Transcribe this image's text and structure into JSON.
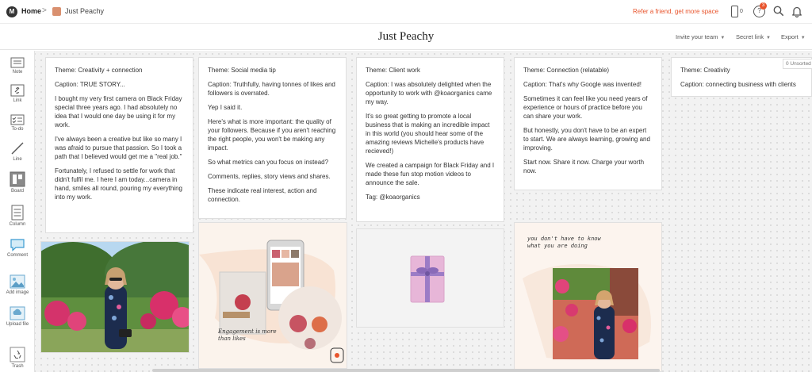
{
  "topbar": {
    "logo_letter": "M",
    "home_label": "Home",
    "separator": ">",
    "board_label": "Just Peachy",
    "refer_label": "Refer a friend, get more space",
    "device_count": "0",
    "notification_count": "3",
    "help_symbol": "?"
  },
  "titlebar": {
    "title": "Just Peachy",
    "invite_label": "Invite your team",
    "secret_link_label": "Secret link",
    "export_label": "Export"
  },
  "toolbar": {
    "items": [
      {
        "label": "Note",
        "icon": "note-icon"
      },
      {
        "label": "Link",
        "icon": "link-icon"
      },
      {
        "label": "To-do",
        "icon": "todo-icon"
      },
      {
        "label": "Line",
        "icon": "line-icon"
      },
      {
        "label": "Board",
        "icon": "board-icon"
      },
      {
        "label": "Column",
        "icon": "column-icon"
      },
      {
        "label": "Comment",
        "icon": "comment-icon"
      },
      {
        "label": "Add image",
        "icon": "image-icon"
      },
      {
        "label": "Upload file",
        "icon": "upload-icon"
      },
      {
        "label": "Trash",
        "icon": "trash-icon"
      }
    ]
  },
  "unsorted_label": "0 Unsorted",
  "cards": [
    {
      "paragraphs": [
        "Theme: Creativity + connection",
        "Caption: TRUE STORY...",
        "I bought my very first camera on Black Friday special three years ago. I had absolutely no idea that I would one day be using it for my work.",
        "I've always been a creative but like so many I was afraid to pursue that passion. So I took a path that I believed would get me a \"real job.\"",
        "Fortunately, I refused to settle for work that didn't fulfil me. I here I am today...camera in hand, smiles all round, pouring my everything into my work."
      ]
    },
    {
      "paragraphs": [
        "Theme: Social media tip",
        "Caption: Truthfully, having tonnes of likes and followers is overrated.",
        "Yep I said it.",
        "Here's what is more important: the quality of your followers. Because if you aren't reaching the right people, you won't be making any impact.",
        "So what metrics can you focus on instead?",
        "Comments, replies, story views and shares.",
        "These indicate real interest, action and connection."
      ]
    },
    {
      "paragraphs": [
        "Theme: Client work",
        "Caption: I was absolutely delighted when the opportunity to work with @koaorganics came my way.",
        "It's so great getting to promote a local business that is making an incredible impact in this world (you should hear some of the amazing reviews Michelle's products have recieved!)",
        "We created a campaign for Black Friday and I made these fun stop motion videos to announce the sale.",
        "Tag: @koaorganics"
      ]
    },
    {
      "paragraphs": [
        "Theme: Connection (relatable)",
        "Caption: That's why Google was invented!",
        "Sometimes it can feel like you need years of experience or hours of practice before you can share your work.",
        "But honestly, you don't have to be an expert to start. We are always learning, growing and improving.",
        "Start now. Share it now. Charge your worth now."
      ]
    },
    {
      "paragraphs": [
        "Theme: Creativity",
        "Caption: connecting business with clients"
      ]
    }
  ],
  "images": {
    "photo2_caption": "Engagement is more than likes",
    "photo4_caption": "you don't have to know what you are doing"
  },
  "colors": {
    "accent": "#e8542c",
    "swatch": "#d9906f"
  }
}
